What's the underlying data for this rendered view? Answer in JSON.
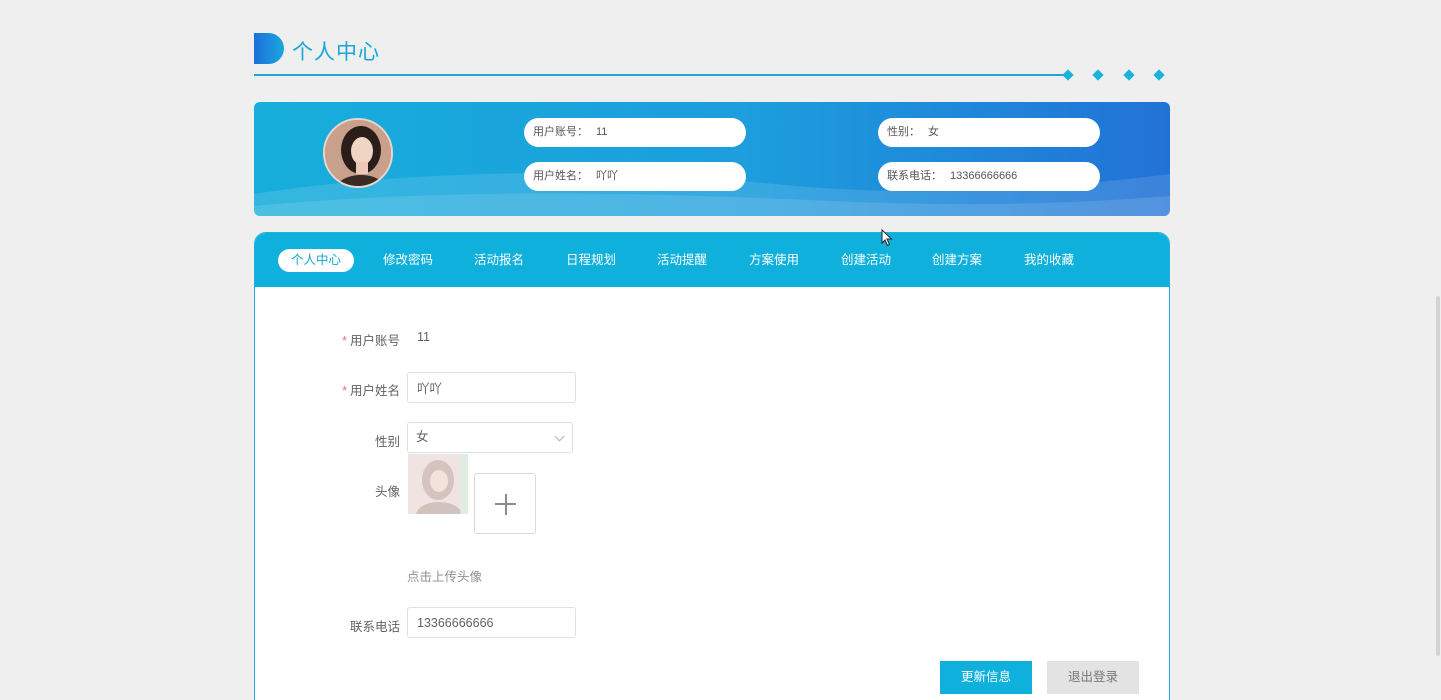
{
  "header": {
    "title": "个人中心"
  },
  "profile_card": {
    "account_label": "用户账号：",
    "account_value": "11",
    "name_label": "用户姓名：",
    "name_value": "吖吖",
    "gender_label": "性别：",
    "gender_value": "女",
    "phone_label": "联系电话：",
    "phone_value": "13366666666"
  },
  "tabs": [
    {
      "label": "个人中心",
      "active": true
    },
    {
      "label": "修改密码"
    },
    {
      "label": "活动报名"
    },
    {
      "label": "日程规划"
    },
    {
      "label": "活动提醒"
    },
    {
      "label": "方案使用"
    },
    {
      "label": "创建活动"
    },
    {
      "label": "创建方案"
    },
    {
      "label": "我的收藏"
    }
  ],
  "form": {
    "required_mark": "*",
    "account_label": "用户账号",
    "account_value": "11",
    "name_label": "用户姓名",
    "name_value": "吖吖",
    "gender_label": "性别",
    "gender_value": "女",
    "avatar_label": "头像",
    "upload_tip": "点击上传头像",
    "phone_label": "联系电话",
    "phone_value": "13366666666"
  },
  "buttons": {
    "update": "更新信息",
    "logout": "退出登录"
  },
  "icons": {
    "upload": "plus-icon",
    "select": "chevron-down-icon",
    "logo": "header-logo-icon"
  },
  "colors": {
    "accent": "#0fb1dc",
    "required": "#f56c6c",
    "banner_end": "#2272d6"
  }
}
